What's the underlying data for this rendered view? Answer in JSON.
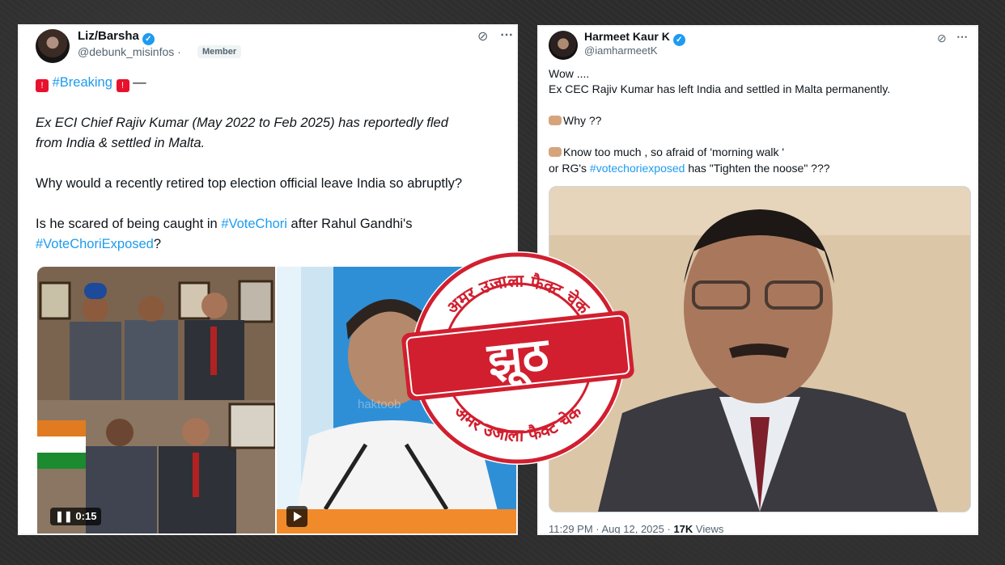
{
  "left_tweet": {
    "author_name": "Liz/Barsha",
    "handle": "@debunk_misinfos ·",
    "badge": "Member",
    "breaking_tag": "#Breaking",
    "breaking_dash": "—",
    "line1": "Ex ECI Chief Rajiv Kumar (May 2022 to Feb 2025) has reportedly fled",
    "line2": "from India & settled in Malta.",
    "question1": "Why would a recently retired top election official leave India so abruptly?",
    "q2_prefix": "Is he scared of being caught in ",
    "q2_tag1": "#VoteChori",
    "q2_mid": " after Rahul Gandhi's",
    "q2_tag2": "#VoteChoriExposed",
    "q2_suffix": "?",
    "video_time": "0:15",
    "watermark": "haktoob"
  },
  "right_tweet": {
    "author_name": "Harmeet Kaur K",
    "handle": "@iamharmeetK",
    "line_wow": "Wow ....",
    "line_main": "Ex CEC Rajiv Kumar has left India and settled in Malta permanently.",
    "line_why": "Why ??",
    "line_know": "Know too much , so afraid of 'morning walk '",
    "line_rg_prefix": "or RG's ",
    "line_rg_tag": "#votechoriexposed",
    "line_rg_suffix": " has \"Tighten the noose\" ???",
    "timestamp": "11:29 PM · Aug 12, 2025 ·",
    "views_count": "17K",
    "views_label": "Views"
  },
  "stamp": {
    "top_arc": "अमर उजाला फैक्ट चेक",
    "bottom_arc": "अमर उजाला फैक्ट चेक",
    "verdict": "झूठ"
  },
  "colors": {
    "link": "#1d9bf0",
    "stamp_red": "#d11f2f"
  }
}
